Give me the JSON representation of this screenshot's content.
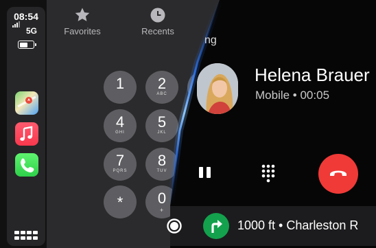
{
  "status": {
    "time": "08:54",
    "network": "5G",
    "battery_percent": 70
  },
  "sidebar": {
    "apps": [
      {
        "name": "Maps",
        "icon": "maps-icon"
      },
      {
        "name": "Music",
        "icon": "music-icon"
      },
      {
        "name": "Phone",
        "icon": "phone-icon"
      }
    ],
    "grid_icon": "app-grid-icon"
  },
  "phone": {
    "tabs": [
      {
        "label": "Favorites",
        "icon": "star-icon"
      },
      {
        "label": "Recents",
        "icon": "clock-icon"
      }
    ],
    "keypad": [
      {
        "digit": "1",
        "letters": ""
      },
      {
        "digit": "2",
        "letters": "ABC"
      },
      {
        "digit": "4",
        "letters": "GHI"
      },
      {
        "digit": "5",
        "letters": "JKL"
      },
      {
        "digit": "7",
        "letters": "PQRS"
      },
      {
        "digit": "8",
        "letters": "TUV"
      },
      {
        "digit": "*",
        "letters": ""
      },
      {
        "digit": "0",
        "letters": "+"
      }
    ]
  },
  "call": {
    "status_fragment": "ng",
    "caller_name": "Helena Brauer",
    "caller_detail": "Mobile • 00:05",
    "controls": [
      "pause-icon",
      "keypad-icon",
      "end-call-icon"
    ],
    "end_call_color": "#ef3a37"
  },
  "navigation": {
    "instruction": "1000 ft • Charleston R",
    "turn_icon": "turn-right-arrow-icon",
    "turn_color": "#13a14d"
  }
}
